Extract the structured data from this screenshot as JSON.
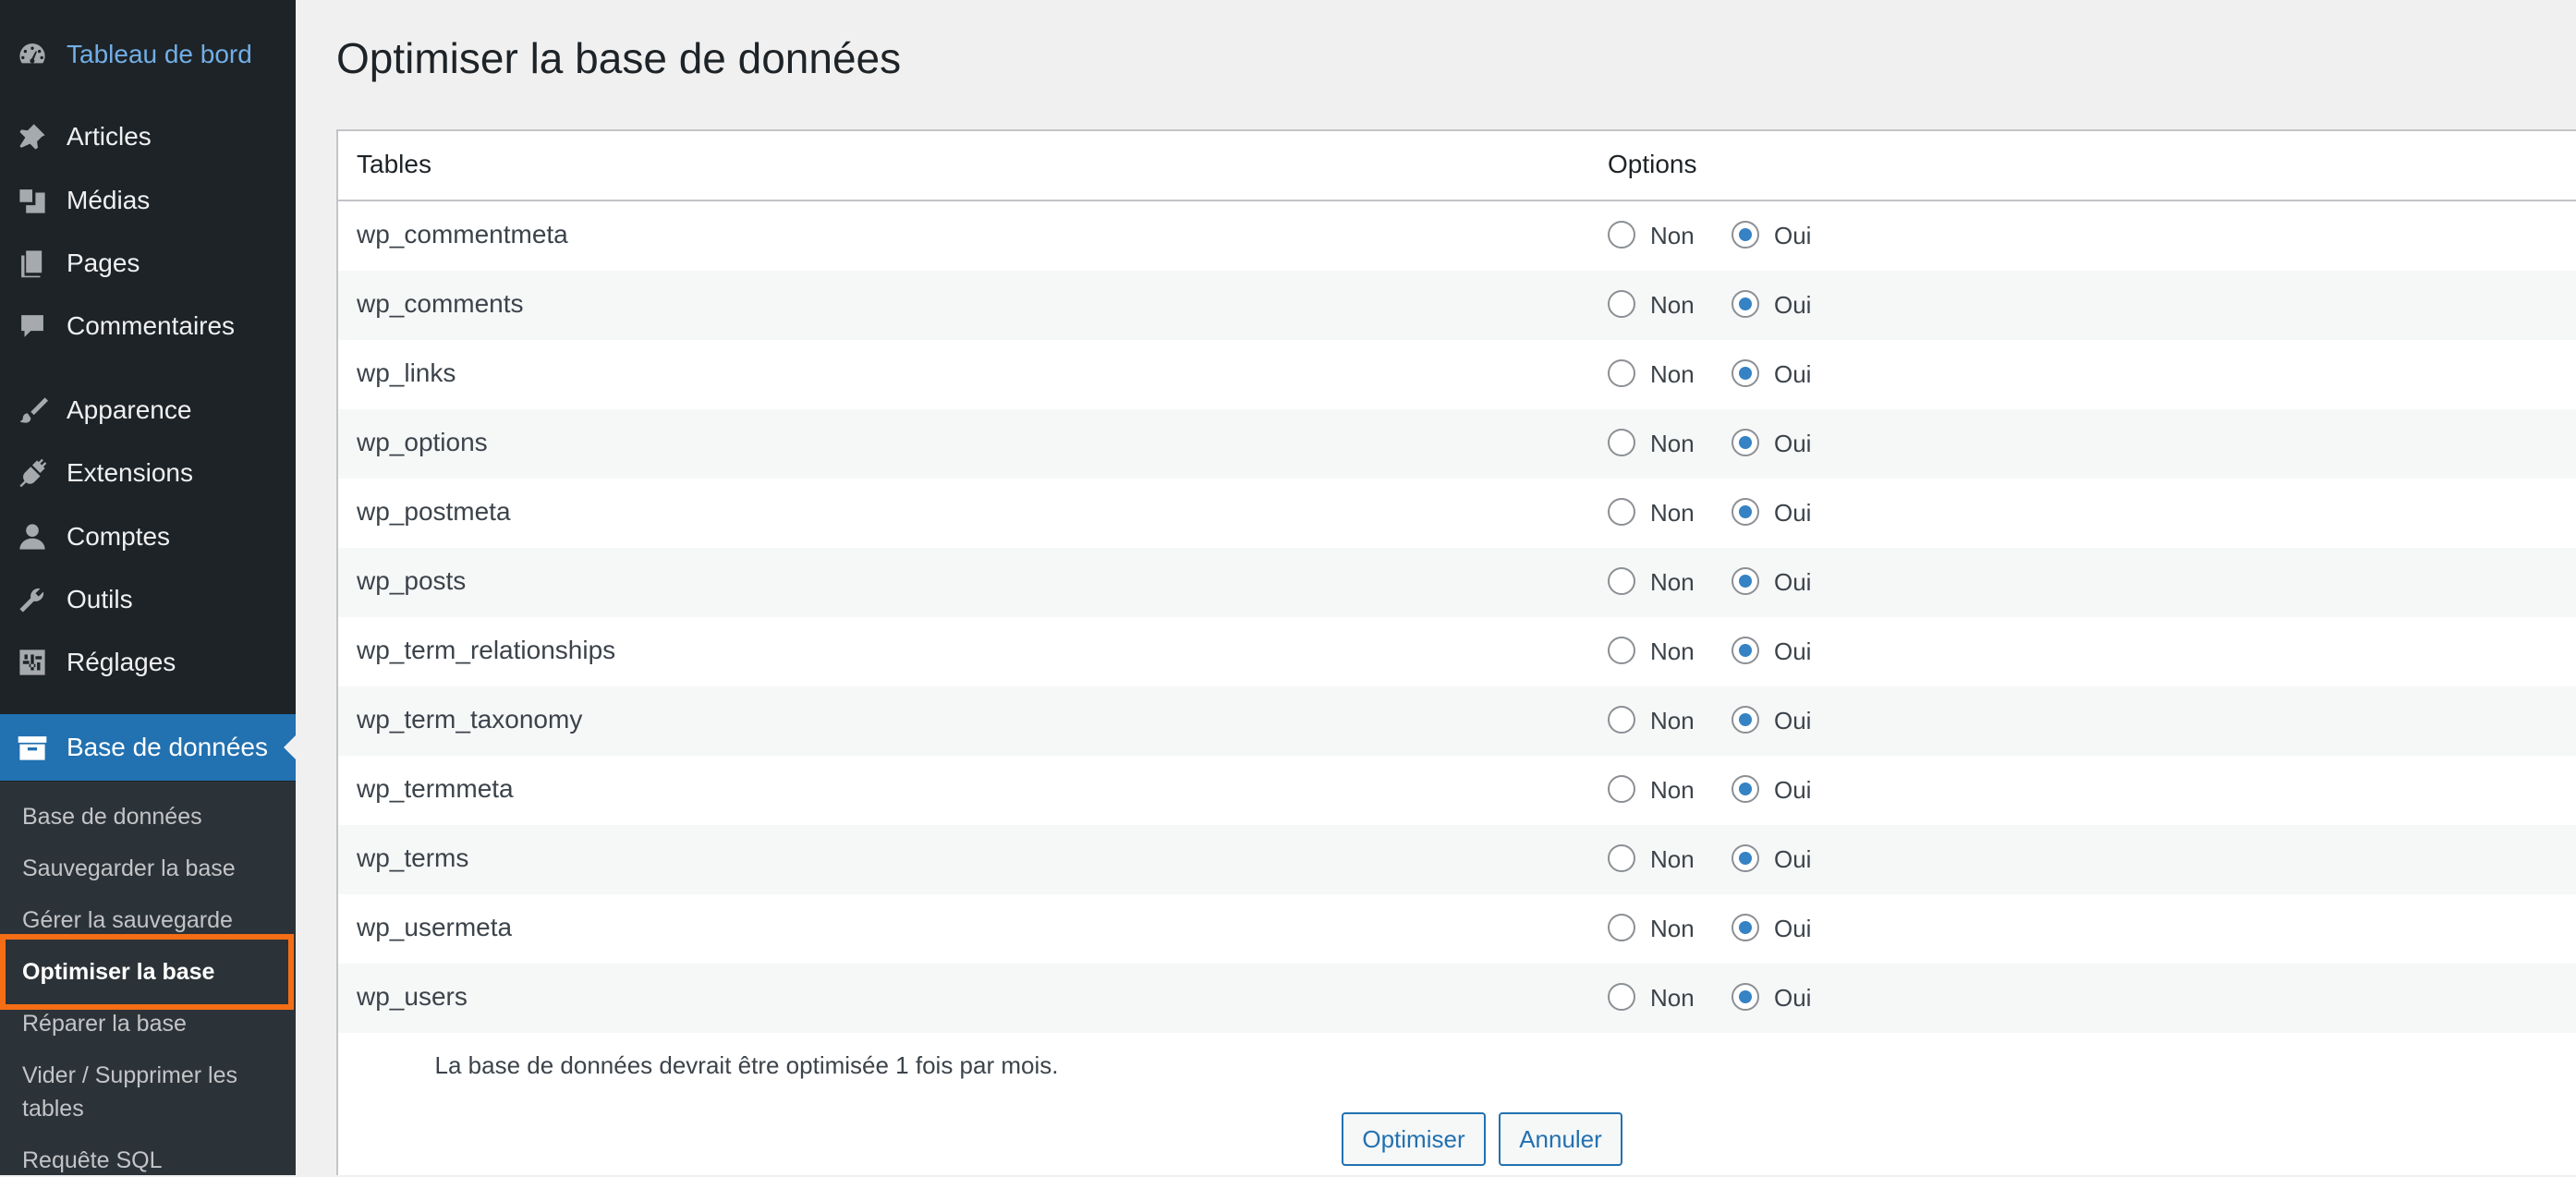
{
  "sidebar": {
    "menu": [
      {
        "label": "Tableau de bord",
        "icon": "dashboard-icon"
      },
      {
        "label": "Articles",
        "icon": "pin-icon"
      },
      {
        "label": "Médias",
        "icon": "media-icon"
      },
      {
        "label": "Pages",
        "icon": "pages-icon"
      },
      {
        "label": "Commentaires",
        "icon": "comment-icon"
      },
      {
        "label": "Apparence",
        "icon": "brush-icon"
      },
      {
        "label": "Extensions",
        "icon": "plugin-icon"
      },
      {
        "label": "Comptes",
        "icon": "user-icon"
      },
      {
        "label": "Outils",
        "icon": "wrench-icon"
      },
      {
        "label": "Réglages",
        "icon": "settings-icon"
      },
      {
        "label": "Base de données",
        "icon": "database-icon"
      }
    ],
    "submenu": [
      {
        "label": "Base de données"
      },
      {
        "label": "Sauvegarder la base"
      },
      {
        "label": "Gérer la sauvegarde"
      },
      {
        "label": "Optimiser la base"
      },
      {
        "label": "Réparer la base"
      },
      {
        "label": "Vider / Supprimer les tables"
      },
      {
        "label": "Requête SQL"
      }
    ]
  },
  "page": {
    "title": "Optimiser la base de données"
  },
  "table": {
    "headers": {
      "tables": "Tables",
      "options": "Options"
    },
    "option_no": "Non",
    "option_yes": "Oui",
    "rows": [
      {
        "name": "wp_commentmeta",
        "selected": "Oui"
      },
      {
        "name": "wp_comments",
        "selected": "Oui"
      },
      {
        "name": "wp_links",
        "selected": "Oui"
      },
      {
        "name": "wp_options",
        "selected": "Oui"
      },
      {
        "name": "wp_postmeta",
        "selected": "Oui"
      },
      {
        "name": "wp_posts",
        "selected": "Oui"
      },
      {
        "name": "wp_term_relationships",
        "selected": "Oui"
      },
      {
        "name": "wp_term_taxonomy",
        "selected": "Oui"
      },
      {
        "name": "wp_termmeta",
        "selected": "Oui"
      },
      {
        "name": "wp_terms",
        "selected": "Oui"
      },
      {
        "name": "wp_usermeta",
        "selected": "Oui"
      },
      {
        "name": "wp_users",
        "selected": "Oui"
      }
    ]
  },
  "note": "La base de données devrait être optimisée 1 fois par mois.",
  "buttons": {
    "optimize": "Optimiser",
    "cancel": "Annuler"
  },
  "colors": {
    "accent": "#2271b1",
    "highlight": "#f56e16",
    "sidebar": "#1d2327"
  }
}
